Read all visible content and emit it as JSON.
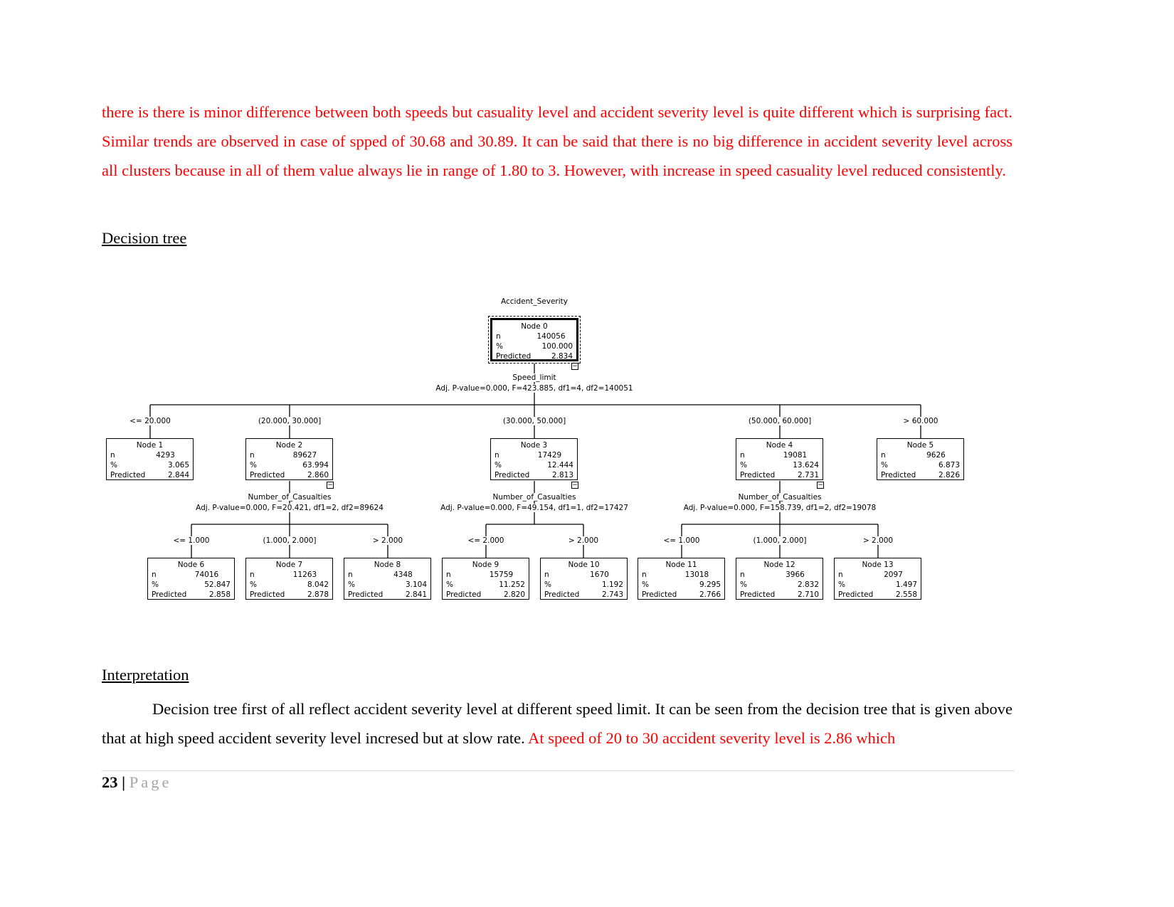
{
  "intro_paragraph": "there is there is minor difference between both speeds but casuality level and accident severity level is quite different which is surprising fact. Similar trends are observed in case of spped of 30.68 and 30.89. It can be said that there is no big difference in accident severity level across all clusters because in all of them value always lie in range of 1.80 to 3. However, with increase in speed casuality level reduced consistently.",
  "heading_decision_tree": "Decision tree",
  "tree": {
    "target": "Accident_Severity",
    "row_labels": {
      "n": "n",
      "pct": "%",
      "pred": "Predicted"
    },
    "collapse_glyph": "−",
    "nodes": [
      {
        "title": "Node 0",
        "n": "140056",
        "pct": "100.000",
        "pred": "2.834"
      },
      {
        "title": "Node 1",
        "n": "4293",
        "pct": "3.065",
        "pred": "2.844",
        "branch": "<= 20.000"
      },
      {
        "title": "Node 2",
        "n": "89627",
        "pct": "63.994",
        "pred": "2.860",
        "branch": "(20.000, 30.000]"
      },
      {
        "title": "Node 3",
        "n": "17429",
        "pct": "12.444",
        "pred": "2.813",
        "branch": "(30.000, 50.000]"
      },
      {
        "title": "Node 4",
        "n": "19081",
        "pct": "13.624",
        "pred": "2.731",
        "branch": "(50.000, 60.000]"
      },
      {
        "title": "Node 5",
        "n": "9626",
        "pct": "6.873",
        "pred": "2.826",
        "branch": "> 60.000"
      },
      {
        "title": "Node 6",
        "n": "74016",
        "pct": "52.847",
        "pred": "2.858",
        "branch": "<= 1.000"
      },
      {
        "title": "Node 7",
        "n": "11263",
        "pct": "8.042",
        "pred": "2.878",
        "branch": "(1.000, 2.000]"
      },
      {
        "title": "Node 8",
        "n": "4348",
        "pct": "3.104",
        "pred": "2.841",
        "branch": "> 2.000"
      },
      {
        "title": "Node 9",
        "n": "15759",
        "pct": "11.252",
        "pred": "2.820",
        "branch": "<= 2.000"
      },
      {
        "title": "Node 10",
        "n": "1670",
        "pct": "1.192",
        "pred": "2.743",
        "branch": "> 2.000"
      },
      {
        "title": "Node 11",
        "n": "13018",
        "pct": "9.295",
        "pred": "2.766",
        "branch": "<= 1.000"
      },
      {
        "title": "Node 12",
        "n": "3966",
        "pct": "2.832",
        "pred": "2.710",
        "branch": "(1.000, 2.000]"
      },
      {
        "title": "Node 13",
        "n": "2097",
        "pct": "1.497",
        "pred": "2.558",
        "branch": "> 2.000"
      }
    ],
    "splits": [
      {
        "variable": "Speed_limit",
        "stats": "Adj. P-value=0.000, F=423.885, df1=4, df2=140051"
      },
      {
        "variable": "Number_of_Casualties",
        "stats": "Adj. P-value=0.000, F=20.421, df1=2, df2=89624"
      },
      {
        "variable": "Number_of_Casualties",
        "stats": "Adj. P-value=0.000, F=49.154, df1=1, df2=17427"
      },
      {
        "variable": "Number_of_Casualties",
        "stats": "Adj. P-value=0.000, F=158.739, df1=2, df2=19078"
      }
    ]
  },
  "heading_interpretation": "Interpretation",
  "interpretation": {
    "black": "Decision tree first of all reflect accident severity level at different speed limit. It can be seen from the decision tree that is given above that at high speed accident severity level incresed but at slow rate.",
    "red": "At speed of 20 to 30 accident severity level  is 2.86 which"
  },
  "footer": {
    "page_number": "23",
    "separator": "|",
    "page_label": "Page"
  }
}
